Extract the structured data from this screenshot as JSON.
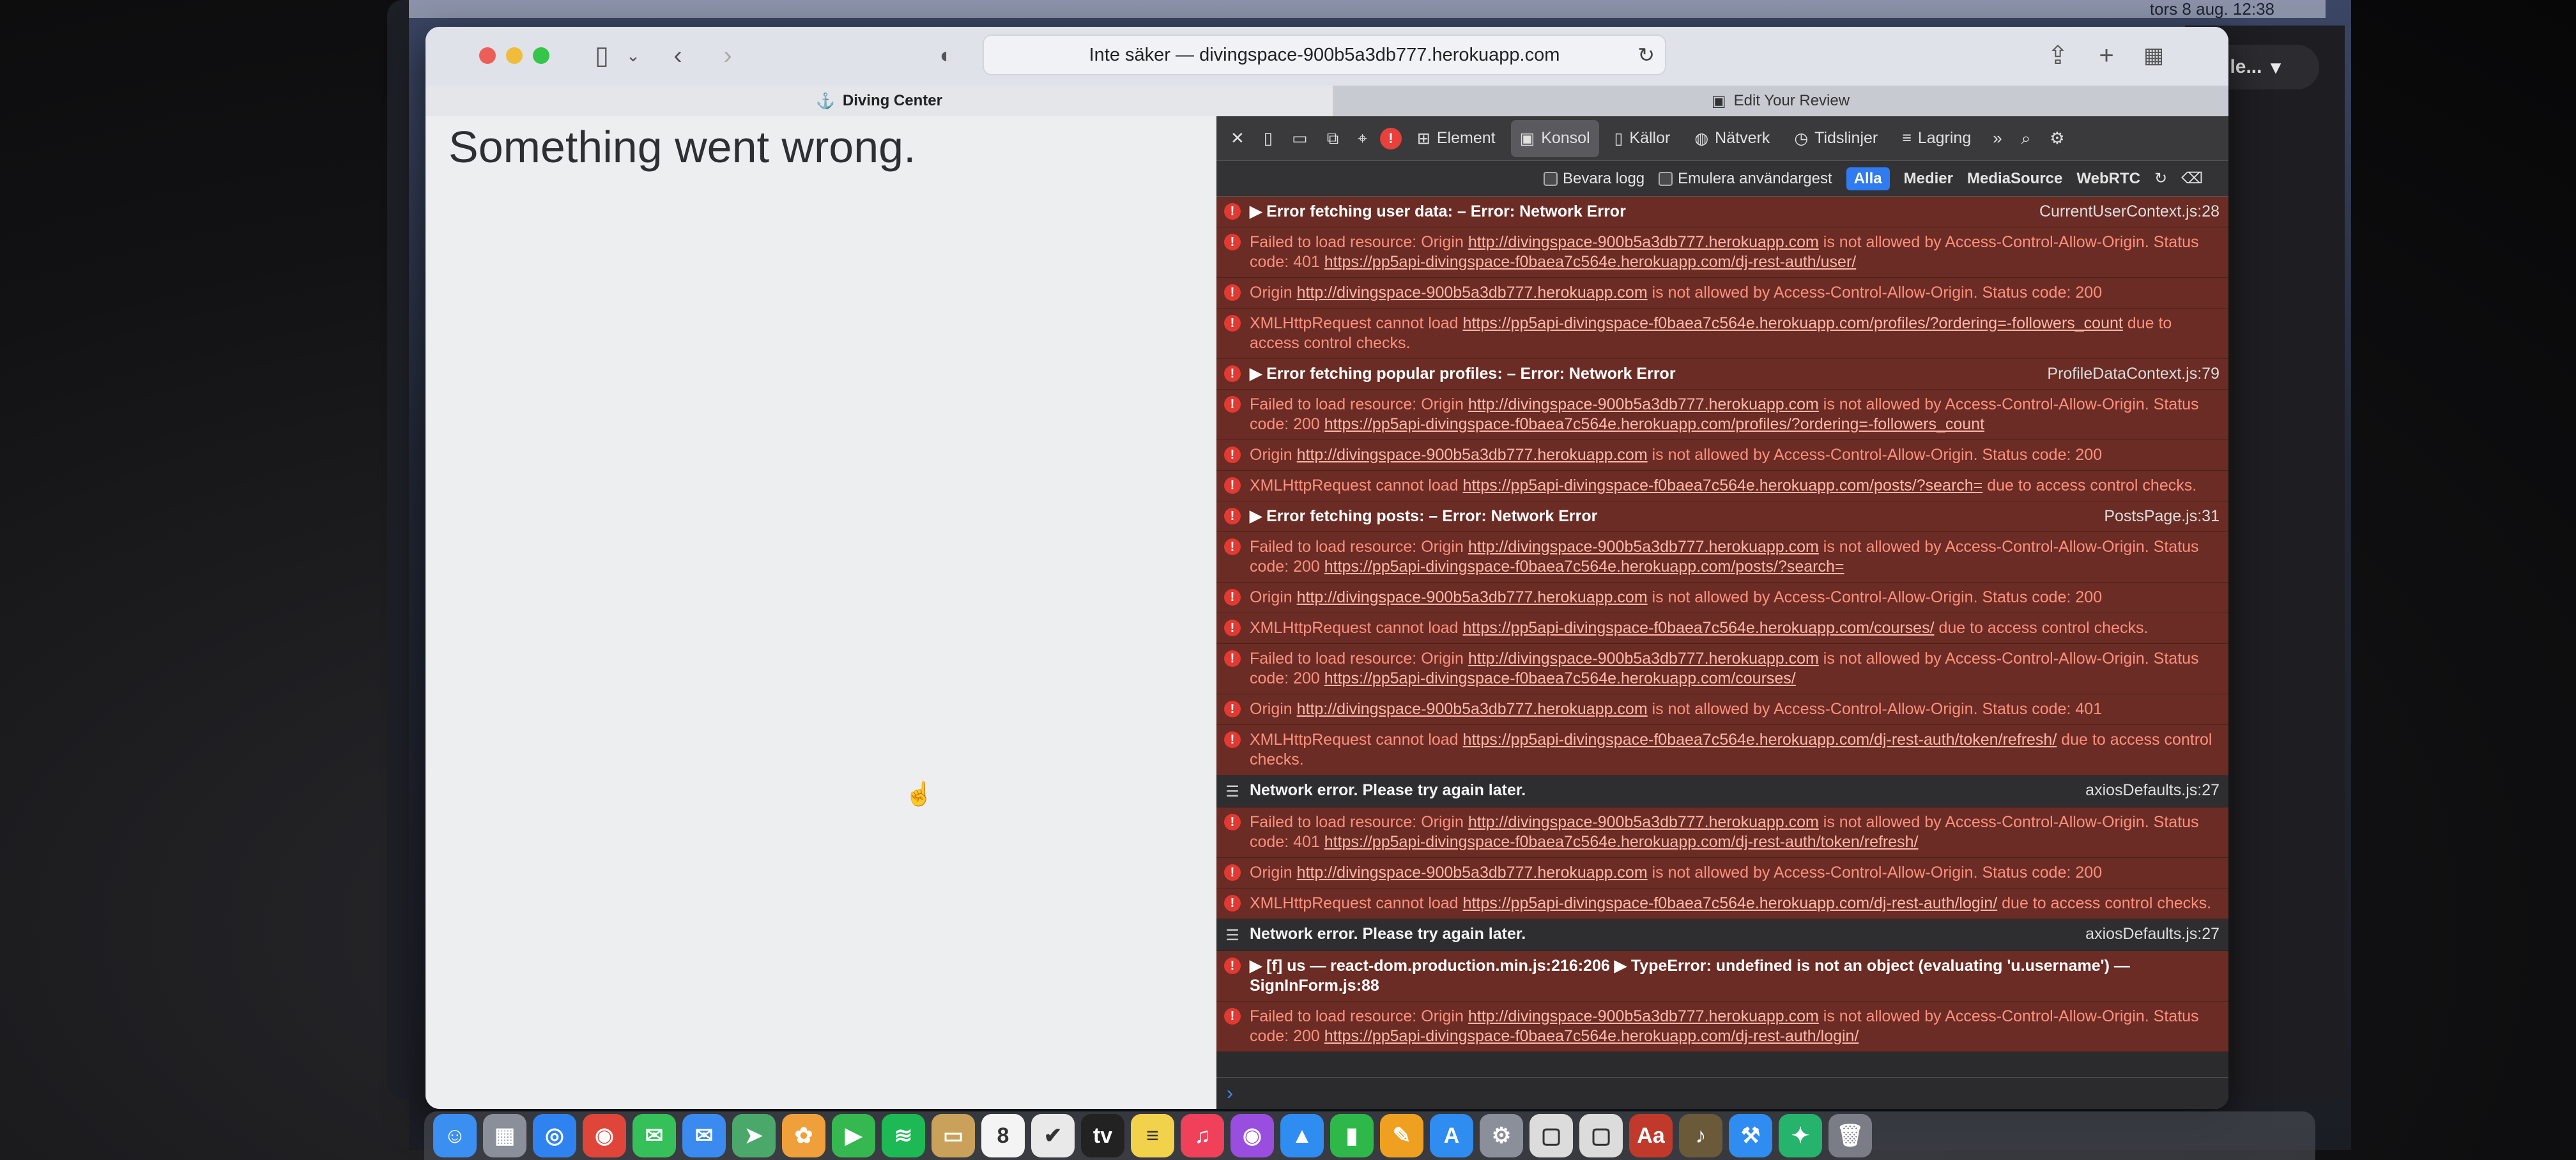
{
  "menubar": {
    "clock": "tors 8 aug.  12:38"
  },
  "right_app": {
    "label": "le..."
  },
  "browser": {
    "url": "Inte säker — divingspace-900b5a3db777.herokuapp.com",
    "tabs": [
      {
        "label": "Diving Center"
      },
      {
        "label": "Edit Your Review"
      }
    ]
  },
  "page": {
    "heading": "Something went wrong."
  },
  "devtools": {
    "error_count": "!",
    "tabs": [
      {
        "label": "Element"
      },
      {
        "label": "Konsol"
      },
      {
        "label": "Källor"
      },
      {
        "label": "Nätverk"
      },
      {
        "label": "Tidslinjer"
      },
      {
        "label": "Lagring"
      }
    ],
    "filters": {
      "preserve_log": "Bevara logg",
      "emulate_gesture": "Emulera användargest",
      "all": "Alla",
      "media": "Medier",
      "mediasource": "MediaSource",
      "webrtc": "WebRTC"
    },
    "console": [
      {
        "type": "error",
        "parts": [
          "▶ Error fetching user data: – Error: Network Error"
        ],
        "src": "CurrentUserContext.js:28"
      },
      {
        "type": "error",
        "parts": [
          "Failed to load resource: Origin ",
          "http://divingspace-900b5a3db777.herokuapp.com",
          " is not allowed by Access-Control-Allow-Origin. Status code: 401 ",
          "https://pp5api-divingspace-f0baea7c564e.herokuapp.com/dj-rest-auth/user/"
        ],
        "src": ""
      },
      {
        "type": "error",
        "parts": [
          "Origin ",
          "http://divingspace-900b5a3db777.herokuapp.com",
          " is not allowed by Access-Control-Allow-Origin. Status code: 200"
        ],
        "src": ""
      },
      {
        "type": "error",
        "parts": [
          "XMLHttpRequest cannot load ",
          "https://pp5api-divingspace-f0baea7c564e.herokuapp.com/profiles/?ordering=-followers_count",
          " due to access control checks."
        ],
        "src": ""
      },
      {
        "type": "error",
        "parts": [
          "▶ Error fetching popular profiles: – Error: Network Error"
        ],
        "src": "ProfileDataContext.js:79"
      },
      {
        "type": "error",
        "parts": [
          "Failed to load resource: Origin ",
          "http://divingspace-900b5a3db777.herokuapp.com",
          " is not allowed by Access-Control-Allow-Origin. Status code: 200 ",
          "https://pp5api-divingspace-f0baea7c564e.herokuapp.com/profiles/?ordering=-followers_count"
        ],
        "src": ""
      },
      {
        "type": "error",
        "parts": [
          "Origin ",
          "http://divingspace-900b5a3db777.herokuapp.com",
          " is not allowed by Access-Control-Allow-Origin. Status code: 200"
        ],
        "src": ""
      },
      {
        "type": "error",
        "parts": [
          "XMLHttpRequest cannot load ",
          "https://pp5api-divingspace-f0baea7c564e.herokuapp.com/posts/?search=",
          " due to access control checks."
        ],
        "src": ""
      },
      {
        "type": "error",
        "parts": [
          "▶ Error fetching posts: – Error: Network Error"
        ],
        "src": "PostsPage.js:31"
      },
      {
        "type": "error",
        "parts": [
          "Failed to load resource: Origin ",
          "http://divingspace-900b5a3db777.herokuapp.com",
          " is not allowed by Access-Control-Allow-Origin. Status code: 200 ",
          "https://pp5api-divingspace-f0baea7c564e.herokuapp.com/posts/?search="
        ],
        "src": ""
      },
      {
        "type": "error",
        "parts": [
          "Origin ",
          "http://divingspace-900b5a3db777.herokuapp.com",
          " is not allowed by Access-Control-Allow-Origin. Status code: 200"
        ],
        "src": ""
      },
      {
        "type": "error",
        "parts": [
          "XMLHttpRequest cannot load ",
          "https://pp5api-divingspace-f0baea7c564e.herokuapp.com/courses/",
          " due to access control checks."
        ],
        "src": ""
      },
      {
        "type": "error",
        "parts": [
          "Failed to load resource: Origin ",
          "http://divingspace-900b5a3db777.herokuapp.com",
          " is not allowed by Access-Control-Allow-Origin. Status code: 200 ",
          "https://pp5api-divingspace-f0baea7c564e.herokuapp.com/courses/"
        ],
        "src": ""
      },
      {
        "type": "error",
        "parts": [
          "Origin ",
          "http://divingspace-900b5a3db777.herokuapp.com",
          " is not allowed by Access-Control-Allow-Origin. Status code: 401"
        ],
        "src": ""
      },
      {
        "type": "error",
        "parts": [
          "XMLHttpRequest cannot load ",
          "https://pp5api-divingspace-f0baea7c564e.herokuapp.com/dj-rest-auth/token/refresh/",
          " due to access control checks."
        ],
        "src": ""
      },
      {
        "type": "info",
        "parts": [
          "Network error. Please try again later."
        ],
        "src": "axiosDefaults.js:27"
      },
      {
        "type": "error",
        "parts": [
          "Failed to load resource: Origin ",
          "http://divingspace-900b5a3db777.herokuapp.com",
          " is not allowed by Access-Control-Allow-Origin. Status code: 401 ",
          "https://pp5api-divingspace-f0baea7c564e.herokuapp.com/dj-rest-auth/token/refresh/"
        ],
        "src": ""
      },
      {
        "type": "error",
        "parts": [
          "Origin ",
          "http://divingspace-900b5a3db777.herokuapp.com",
          " is not allowed by Access-Control-Allow-Origin. Status code: 200"
        ],
        "src": ""
      },
      {
        "type": "error",
        "parts": [
          "XMLHttpRequest cannot load ",
          "https://pp5api-divingspace-f0baea7c564e.herokuapp.com/dj-rest-auth/login/",
          " due to access control checks."
        ],
        "src": ""
      },
      {
        "type": "info",
        "parts": [
          "Network error. Please try again later."
        ],
        "src": "axiosDefaults.js:27"
      },
      {
        "type": "error",
        "parts": [
          "▶ [f] us — react-dom.production.min.js:216:206  ▶ TypeError: undefined is not an object (evaluating 'u.username') — SignInForm.js:88"
        ],
        "src": ""
      },
      {
        "type": "error",
        "parts": [
          "Failed to load resource: Origin ",
          "http://divingspace-900b5a3db777.herokuapp.com",
          " is not allowed by Access-Control-Allow-Origin. Status code: 200 ",
          "https://pp5api-divingspace-f0baea7c564e.herokuapp.com/dj-rest-auth/login/"
        ],
        "src": ""
      }
    ],
    "prompt": "›"
  },
  "dock": {
    "items": [
      {
        "name": "finder-icon",
        "glyph": "☺",
        "color": "#3a8ff0"
      },
      {
        "name": "launchpad-icon",
        "glyph": "▦",
        "color": "#8a8f9a"
      },
      {
        "name": "safari-icon",
        "glyph": "◎",
        "color": "#2f83f0"
      },
      {
        "name": "chrome-icon",
        "glyph": "◉",
        "color": "#e0453a"
      },
      {
        "name": "messages-icon",
        "glyph": "✉",
        "color": "#35c05a"
      },
      {
        "name": "mail-icon",
        "glyph": "✉",
        "color": "#3b8af0"
      },
      {
        "name": "maps-icon",
        "glyph": "➤",
        "color": "#4aa86a"
      },
      {
        "name": "photos-icon",
        "glyph": "✿",
        "color": "#f0a03a"
      },
      {
        "name": "facetime-icon",
        "glyph": "▶",
        "color": "#34b84f"
      },
      {
        "name": "spotify-icon",
        "glyph": "≋",
        "color": "#1db954"
      },
      {
        "name": "notes-folder-icon",
        "glyph": "▭",
        "color": "#c9a15a"
      },
      {
        "name": "calendar-icon",
        "glyph": "8",
        "color": "#f4f4f4"
      },
      {
        "name": "reminders-icon",
        "glyph": "✔",
        "color": "#e9e9e9"
      },
      {
        "name": "tv-icon",
        "glyph": "tv",
        "color": "#222"
      },
      {
        "name": "notes-icon",
        "glyph": "≡",
        "color": "#f1d24a"
      },
      {
        "name": "music-icon",
        "glyph": "♫",
        "color": "#f0405a"
      },
      {
        "name": "podcasts-icon",
        "glyph": "◉",
        "color": "#9a4ee0"
      },
      {
        "name": "keynote-icon",
        "glyph": "▲",
        "color": "#2f8cf0"
      },
      {
        "name": "numbers-icon",
        "glyph": "▮",
        "color": "#2fb84a"
      },
      {
        "name": "pages-icon",
        "glyph": "✎",
        "color": "#f0a020"
      },
      {
        "name": "appstore-icon",
        "glyph": "A",
        "color": "#2f8cf0"
      },
      {
        "name": "settings-icon",
        "glyph": "⚙",
        "color": "#8a8f9a"
      },
      {
        "name": "preview-icon",
        "glyph": "▢",
        "color": "#dcdcdc"
      },
      {
        "name": "preview2-icon",
        "glyph": "▢",
        "color": "#dcdcdc"
      },
      {
        "name": "dictionary-icon",
        "glyph": "Aa",
        "color": "#c0392b"
      },
      {
        "name": "guitar-icon",
        "glyph": "♪",
        "color": "#6b5a3a"
      },
      {
        "name": "xcode-icon",
        "glyph": "⚒",
        "color": "#2f8cf0"
      },
      {
        "name": "spark-icon",
        "glyph": "✦",
        "color": "#26b36b"
      },
      {
        "name": "trash-icon",
        "glyph": "🗑",
        "color": "#7a7d86"
      }
    ]
  }
}
